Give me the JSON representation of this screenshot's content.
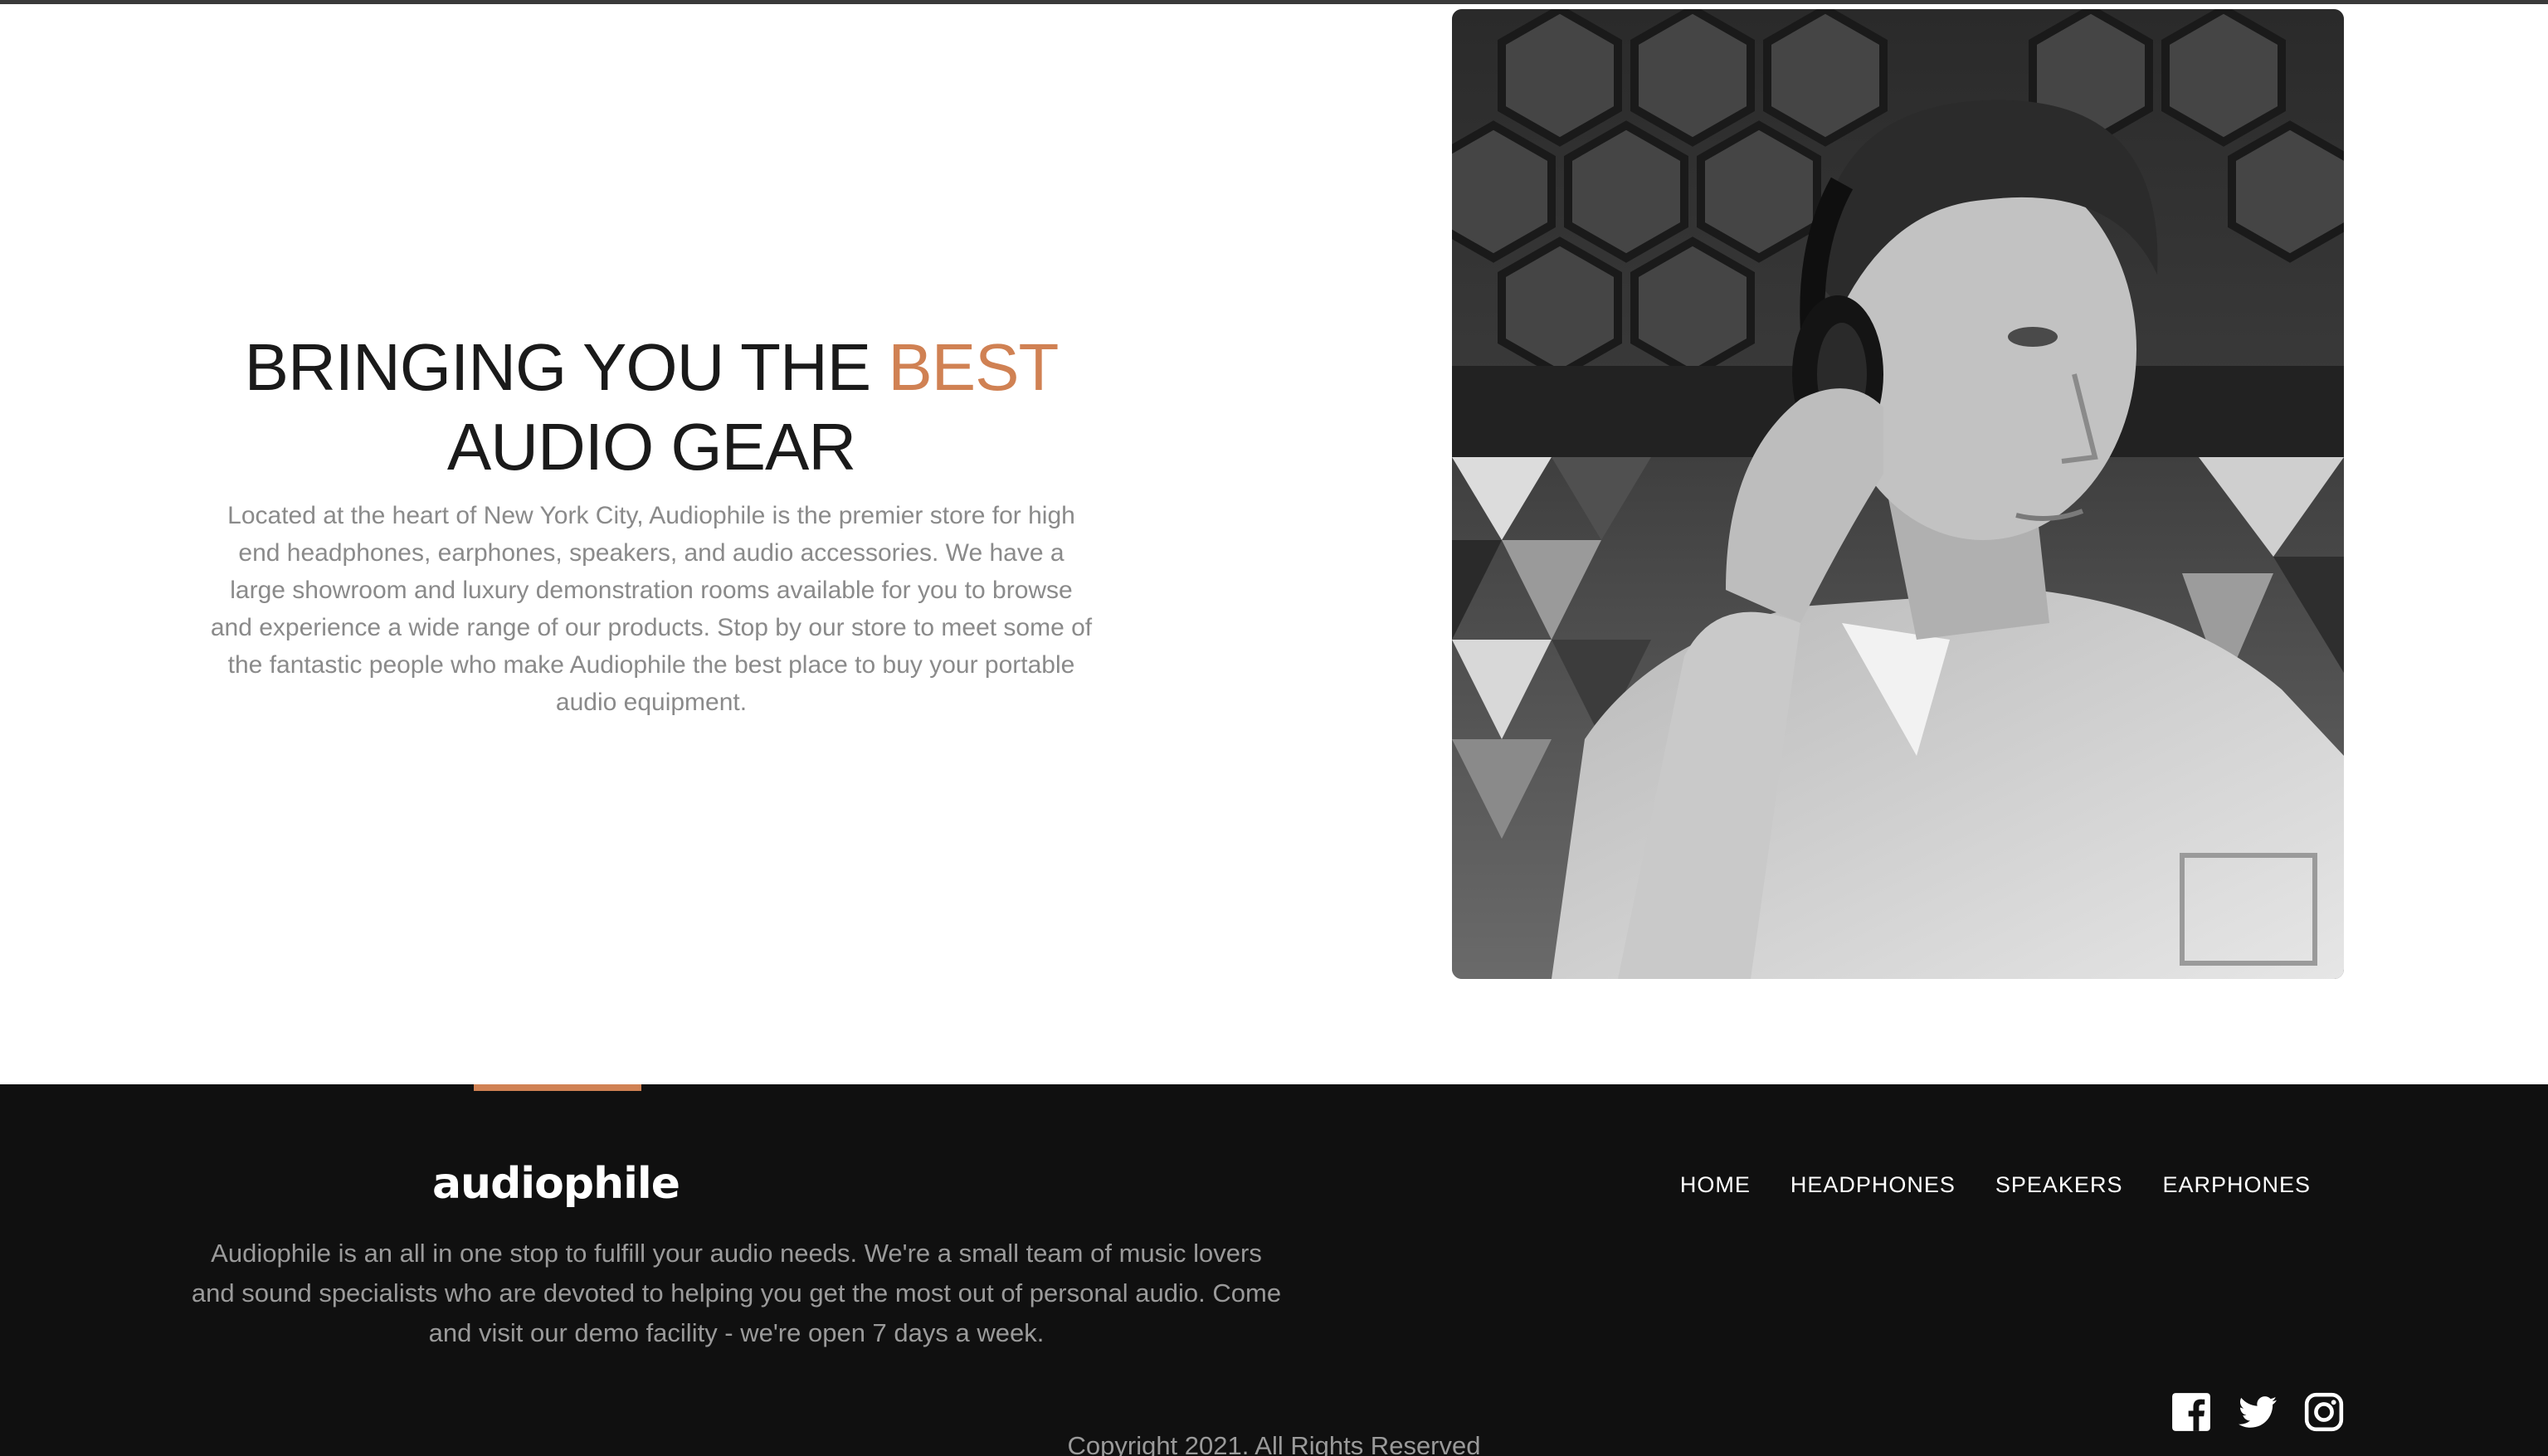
{
  "gear": {
    "title_part1": "BRINGING YOU THE ",
    "title_accent": "BEST",
    "title_part2": "AUDIO GEAR",
    "description": "Located at the heart of New York City, Audiophile is the premier store for high end headphones, earphones, speakers, and audio accessories. We have a large showroom and luxury demonstration rooms available for you to browse and experience a wide range of our products. Stop by our store to meet some of the fantastic people who make Audiophile the best place to buy your portable audio equipment.",
    "image_alt": "man wearing headphones"
  },
  "footer": {
    "logo": "audiophile",
    "description": "Audiophile is an all in one stop to fulfill your audio needs. We're a small team of music lovers and sound specialists who are devoted to helping you get the most out of personal audio. Come and visit our demo facility - we're open 7 days a week.",
    "nav": [
      "HOME",
      "HEADPHONES",
      "SPEAKERS",
      "EARPHONES"
    ],
    "socials": [
      "facebook-icon",
      "twitter-icon",
      "instagram-icon"
    ],
    "copyright": "Copyright 2021. All Rights Reserved"
  },
  "colors": {
    "accent": "#d08153",
    "footer_bg": "#101010",
    "text_dark": "#1a1a1a",
    "text_muted": "#8a8a8a"
  }
}
